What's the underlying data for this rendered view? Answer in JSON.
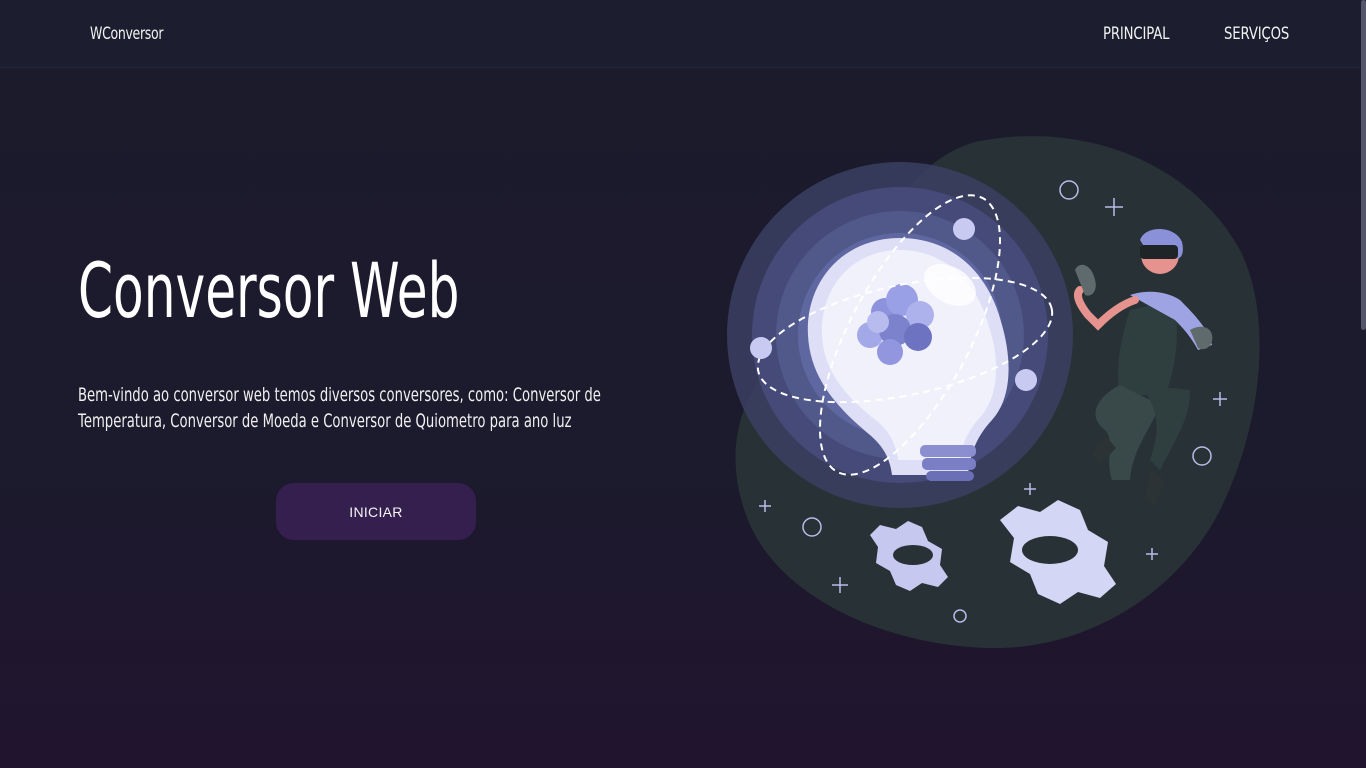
{
  "navbar": {
    "brand": "WConversor",
    "links": [
      "PRINCIPAL",
      "SERVIÇOS"
    ]
  },
  "hero": {
    "title": "Conversor Web",
    "description": "Bem-vindo ao conversor web temos diversos conversores, como: Conversor de Temperatura, Conversor de Moeda e Conversor de Quiometro para ano luz",
    "button_label": "INICIAR"
  },
  "illustration": {
    "icon": "lightbulb-atom-gears-person-illustration"
  },
  "colors": {
    "background": "#1b1b2c",
    "navbar": "#1c1e2f",
    "button": "#351f4f",
    "blob": "#283236",
    "accent": "#a7a9e8"
  }
}
